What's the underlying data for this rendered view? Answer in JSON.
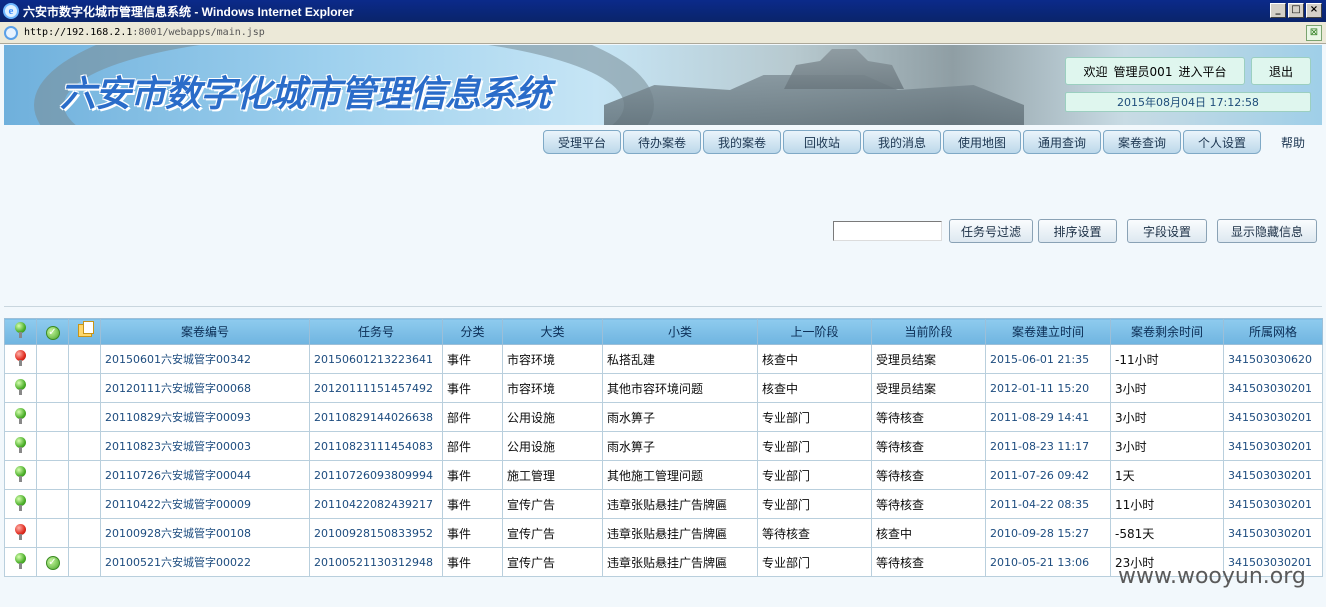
{
  "window": {
    "title": "六安市数字化城市管理信息系统 - Windows Internet Explorer",
    "controls": [
      "_",
      "□",
      "×"
    ]
  },
  "address_bar": {
    "host": "http://192.168.2.1",
    "path": ":8001/webapps/main.jsp"
  },
  "header": {
    "app_title": "六安市数字化城市管理信息系统",
    "welcome": "欢迎",
    "user": "管理员001",
    "enter_platform": "进入平台",
    "logout": "退出",
    "datetime": "2015年08月04日  17:12:58"
  },
  "nav": {
    "items": [
      "受理平台",
      "待办案卷",
      "我的案卷",
      "回收站",
      "我的消息",
      "使用地图",
      "通用查询",
      "案卷查询",
      "个人设置"
    ],
    "help": "帮助"
  },
  "toolbar": {
    "filter_value": "",
    "task_filter": "任务号过滤",
    "sort_settings": "排序设置",
    "field_settings": "字段设置",
    "show_hidden": "显示隐藏信息"
  },
  "table": {
    "columns": [
      "案卷编号",
      "任务号",
      "分类",
      "大类",
      "小类",
      "上一阶段",
      "当前阶段",
      "案卷建立时间",
      "案卷剩余时间",
      "所属网格"
    ],
    "rows": [
      {
        "status": "red",
        "checked": false,
        "case_id": "20150601六安城管字00342",
        "task_id": "20150601213223641",
        "category": "事件",
        "major": "市容环境",
        "minor": "私搭乱建",
        "prev_stage": "核查中",
        "cur_stage": "受理员结案",
        "created": "2015-06-01 21:35",
        "remaining": "-11小时",
        "grid": "341503030620"
      },
      {
        "status": "green",
        "checked": false,
        "case_id": "20120111六安城管字00068",
        "task_id": "20120111151457492",
        "category": "事件",
        "major": "市容环境",
        "minor": "其他市容环境问题",
        "prev_stage": "核查中",
        "cur_stage": "受理员结案",
        "created": "2012-01-11 15:20",
        "remaining": "3小时",
        "grid": "341503030201"
      },
      {
        "status": "green",
        "checked": false,
        "case_id": "20110829六安城管字00093",
        "task_id": "20110829144026638",
        "category": "部件",
        "major": "公用设施",
        "minor": "雨水箅子",
        "prev_stage": "专业部门",
        "cur_stage": "等待核查",
        "created": "2011-08-29 14:41",
        "remaining": "3小时",
        "grid": "341503030201"
      },
      {
        "status": "green",
        "checked": false,
        "case_id": "20110823六安城管字00003",
        "task_id": "20110823111454083",
        "category": "部件",
        "major": "公用设施",
        "minor": "雨水箅子",
        "prev_stage": "专业部门",
        "cur_stage": "等待核查",
        "created": "2011-08-23 11:17",
        "remaining": "3小时",
        "grid": "341503030201"
      },
      {
        "status": "green",
        "checked": false,
        "case_id": "20110726六安城管字00044",
        "task_id": "20110726093809994",
        "category": "事件",
        "major": "施工管理",
        "minor": "其他施工管理问题",
        "prev_stage": "专业部门",
        "cur_stage": "等待核查",
        "created": "2011-07-26 09:42",
        "remaining": "1天",
        "grid": "341503030201"
      },
      {
        "status": "green",
        "checked": false,
        "case_id": "20110422六安城管字00009",
        "task_id": "20110422082439217",
        "category": "事件",
        "major": "宣传广告",
        "minor": "违章张贴悬挂广告牌匾",
        "prev_stage": "专业部门",
        "cur_stage": "等待核查",
        "created": "2011-04-22 08:35",
        "remaining": "11小时",
        "grid": "341503030201"
      },
      {
        "status": "red",
        "checked": false,
        "case_id": "20100928六安城管字00108",
        "task_id": "20100928150833952",
        "category": "事件",
        "major": "宣传广告",
        "minor": "违章张贴悬挂广告牌匾",
        "prev_stage": "等待核查",
        "cur_stage": "核查中",
        "created": "2010-09-28 15:27",
        "remaining": "-581天",
        "grid": "341503030201"
      },
      {
        "status": "green",
        "checked": true,
        "case_id": "20100521六安城管字00022",
        "task_id": "20100521130312948",
        "category": "事件",
        "major": "宣传广告",
        "minor": "违章张贴悬挂广告牌匾",
        "prev_stage": "专业部门",
        "cur_stage": "等待核查",
        "created": "2010-05-21 13:06",
        "remaining": "23小时",
        "grid": "341503030201"
      }
    ]
  },
  "watermark": "www.wooyun.org",
  "colors": {
    "header_blue": "#0a246a",
    "table_header": "#8ecbee",
    "status_green": "#4caf2a",
    "status_red": "#e02b1f"
  }
}
